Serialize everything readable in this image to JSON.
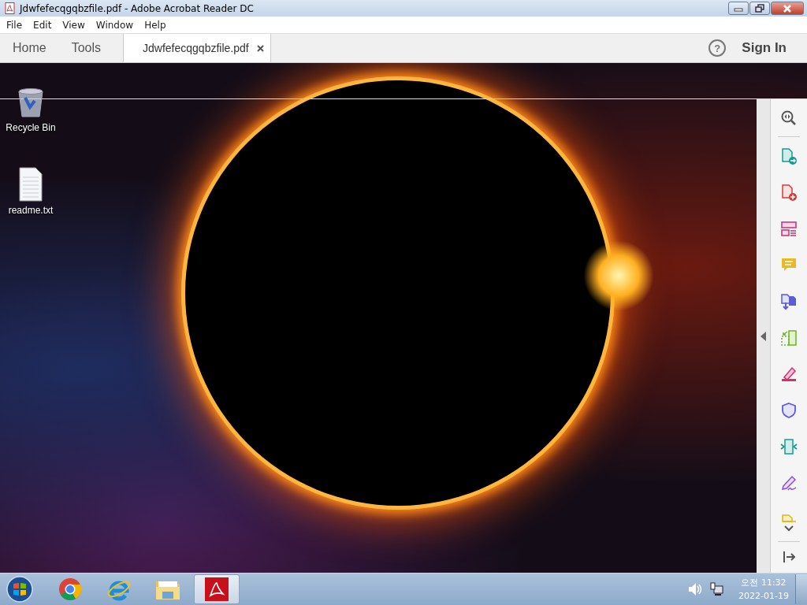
{
  "window": {
    "title": "Jdwfefecqgqbzfile.pdf - Adobe Acrobat Reader DC"
  },
  "menu": [
    "File",
    "Edit",
    "View",
    "Window",
    "Help"
  ],
  "tabs": [
    {
      "label": "Home",
      "selected": false
    },
    {
      "label": "Tools",
      "selected": false
    },
    {
      "label": "Jdwfefecqgqbzfile.pdf",
      "selected": true
    }
  ],
  "help_button": "?",
  "sign_in": "Sign In",
  "desktop_icons": [
    {
      "label": "Recycle Bin",
      "kind": "recycle-bin"
    },
    {
      "label": "readme.txt",
      "kind": "text-file"
    }
  ],
  "taskbar": {
    "apps": [
      {
        "kind": "chrome",
        "selected": false
      },
      {
        "kind": "ie",
        "selected": false
      },
      {
        "kind": "folder",
        "selected": false
      },
      {
        "kind": "acrobat",
        "selected": true
      }
    ],
    "time": "오전 11:32",
    "date": "2022-01-19"
  }
}
